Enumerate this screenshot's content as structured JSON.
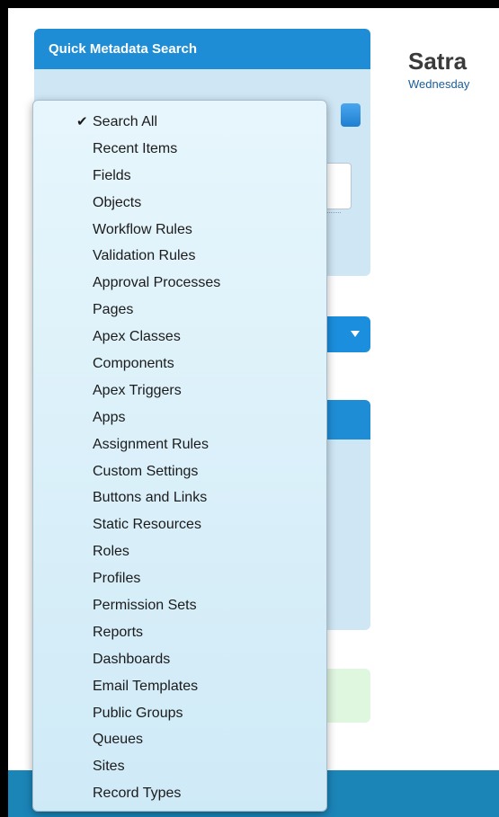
{
  "sidebar": {
    "quick_search_title": "Quick Metadata Search"
  },
  "main": {
    "title": "Satra",
    "subtitle": "Wednesday"
  },
  "dropdown": {
    "selected": "Search All",
    "options": [
      {
        "label": "Search All",
        "checked": true
      },
      {
        "label": "Recent Items"
      },
      {
        "label": "Fields"
      },
      {
        "label": "Objects"
      },
      {
        "label": "Workflow Rules"
      },
      {
        "label": "Validation Rules"
      },
      {
        "label": "Approval Processes"
      },
      {
        "label": "Pages"
      },
      {
        "label": "Apex Classes"
      },
      {
        "label": "Components"
      },
      {
        "label": "Apex Triggers"
      },
      {
        "label": "Apps"
      },
      {
        "label": "Assignment Rules"
      },
      {
        "label": "Custom Settings"
      },
      {
        "label": "Buttons and Links"
      },
      {
        "label": "Static Resources"
      },
      {
        "label": "Roles"
      },
      {
        "label": "Profiles"
      },
      {
        "label": "Permission Sets"
      },
      {
        "label": "Reports"
      },
      {
        "label": "Dashboards"
      },
      {
        "label": "Email Templates"
      },
      {
        "label": "Public Groups"
      },
      {
        "label": "Queues"
      },
      {
        "label": "Sites"
      },
      {
        "label": "Record Types"
      }
    ]
  },
  "icons": {
    "check": "checkmark-icon",
    "search": "search-icon",
    "chevron": "chevron-down-icon"
  },
  "colors": {
    "accent": "#1f8dd6",
    "panel": "#cfe7f5",
    "footer": "#1b85b8"
  }
}
